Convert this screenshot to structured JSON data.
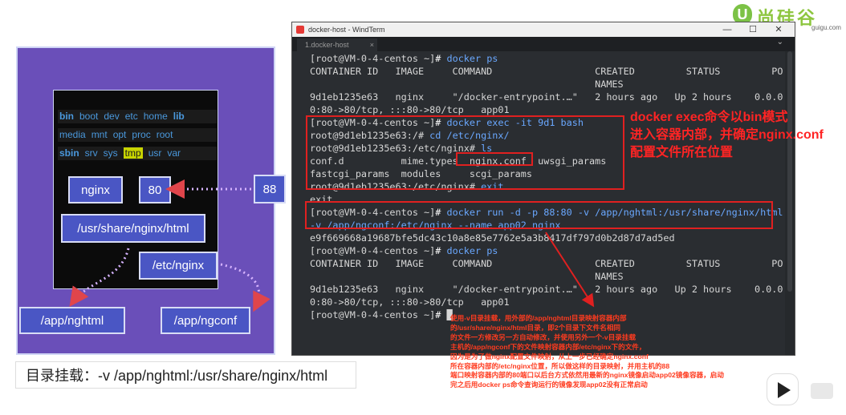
{
  "logo": {
    "icon": "U",
    "brand": "尚硅谷",
    "url": "guigu.com"
  },
  "diagram": {
    "dirs_row1": [
      "bin",
      "boot",
      "dev",
      "etc",
      "home",
      "lib"
    ],
    "dirs_row2": [
      "media",
      "mnt",
      "opt",
      "proc",
      "root"
    ],
    "dirs_row3": [
      "sbin",
      "srv",
      "sys",
      "tmp",
      "usr",
      "var"
    ],
    "nginx": "nginx",
    "port_container": "80",
    "port_host": "88",
    "html_path": "/usr/share/nginx/html",
    "etc_path": "/etc/nginx",
    "host_html": "/app/nghtml",
    "host_conf": "/app/ngconf",
    "caption": "目录挂载：-v /app/nghtml:/usr/share/nginx/html"
  },
  "window": {
    "title": "docker-host - WindTerm",
    "tab": "1.docker-host",
    "tab_close": "×",
    "controls": {
      "minimize": "—",
      "maximize": "☐",
      "close": "✕"
    }
  },
  "terminal": {
    "prompt_host": "[root@VM-0-4-centos ~]",
    "prompt_container": "root@9d1eb1235e63:",
    "cmd_ps": "docker ps",
    "header": "CONTAINER ID   IMAGE     COMMAND                  CREATED         STATUS         PORTS",
    "header_names": "                                                  NAMES",
    "row_a": "9d1eb1235e63   nginx     \"/docker-entrypoint.…\"   2 hours ago   Up 2 hours    0.0.0.",
    "row_b": "0:80->80/tcp, :::80->80/tcp   app01",
    "cmd_exec": "docker exec -it 9d1 bash",
    "cd_dir": "/# ",
    "cmd_cd": "cd /etc/nginx/",
    "nginx_dir": "/etc/nginx# ",
    "cmd_ls": "ls",
    "ls_row1_a": "conf.d          mime.types  ",
    "ls_row1_b": "nginx.conf",
    "ls_row1_c": "  uwsgi_params",
    "ls_row2": "fastcgi_params  modules     scgi_params",
    "cmd_exit": "exit",
    "out_exit": "exit",
    "cmd_run_1": "docker run -d -p 88:80 -v /app/nghtml:/usr/share/nginx/html",
    "cmd_run_2": "-v /app/ngconf:/etc/nginx --name app02 nginx",
    "run_output": "e9f669668a19687bfe5dc43c10a8e85e7762e5a3b8417df797d0b2d87d7ad5ed",
    "cursor": "█"
  },
  "annotations": {
    "exec_note": [
      "docker exec命令以bin模式",
      "进入容器内部，并确定nginx.conf",
      "配置文件所在位置"
    ],
    "bottom_note": [
      "使用-v目录挂载，用外部的/app/nghtml目录映射容器内部",
      "的/usr/share/nginx/html目录，即2个目录下文件名相同",
      "的文件一方修改另一方自动修改，并使用另外一个-v目录挂载",
      "主机的/app/ngconf下的文件映射容器内部/etc/nginx下的文件，",
      "因为是为了做nginx配置文件映射，从上一步已经确定nginx.conf",
      "所在容器内部的/etc/nginx位置，所以做这样的目录映射，并用主机的88",
      "端口映射容器内部的80端口以后台方式依然用最新的nginx镜像启动app02镜像容器，启动",
      "完之后用docker ps命令查询运行的镜像发现app02没有正常启动"
    ]
  }
}
